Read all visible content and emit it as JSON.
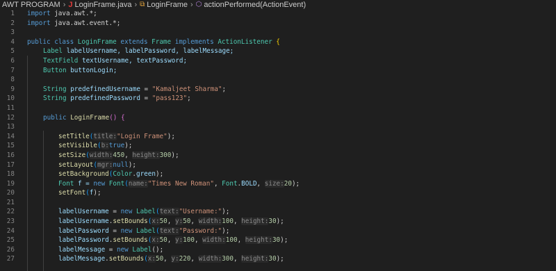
{
  "breadcrumb": {
    "project": "AWT PROGRAM",
    "file": "LoginFrame.java",
    "class": "LoginFrame",
    "method": "actionPerformed(ActionEvent)"
  },
  "line_numbers": [
    "1",
    "2",
    "3",
    "4",
    "5",
    "6",
    "7",
    "8",
    "9",
    "10",
    "11",
    "12",
    "13",
    "14",
    "15",
    "16",
    "17",
    "18",
    "19",
    "20",
    "21",
    "22",
    "23",
    "24",
    "25",
    "26",
    "27"
  ],
  "code": {
    "l1": [
      "import",
      " java.awt.*;"
    ],
    "l2": [
      "import",
      " java.awt.event.*;"
    ],
    "l4": [
      "public",
      " class ",
      "LoginFrame",
      " extends ",
      "Frame",
      " implements ",
      "ActionListener",
      " ",
      "{"
    ],
    "l5": [
      "Label",
      " labelUsername, labelPassword, labelMessage;"
    ],
    "l6": [
      "TextField",
      " textUsername, textPassword;"
    ],
    "l7": [
      "Button",
      " buttonLogin;"
    ],
    "l9": [
      "String",
      " predefinedUsername",
      " = ",
      "\"Kamaljeet Sharma\"",
      ";"
    ],
    "l10": [
      "String",
      " predefinedPassword",
      " = ",
      "\"pass123\"",
      ";"
    ],
    "l12": [
      "public",
      " ",
      "LoginFrame",
      "()",
      " ",
      "{"
    ],
    "l14": [
      "setTitle",
      "(",
      "title:",
      "\"Login Frame\"",
      ");"
    ],
    "l15": [
      "setVisible",
      "(",
      "b:",
      "true",
      ");"
    ],
    "l16": [
      "setSize",
      "(",
      "width:",
      "450",
      ", ",
      "height:",
      "300",
      ");"
    ],
    "l17": [
      "setLayout",
      "(",
      "mgr:",
      "null",
      ");"
    ],
    "l18": [
      "setBackground",
      "(",
      "Color",
      ".",
      "green",
      ");"
    ],
    "l19": [
      "Font",
      " f = ",
      "new",
      " ",
      "Font",
      "(",
      "name:",
      "\"Times New Roman\"",
      ", ",
      "Font",
      ".",
      "BOLD",
      ", ",
      "size:",
      "20",
      ");"
    ],
    "l20": [
      "setFont",
      "(",
      "f",
      ");"
    ],
    "l22": [
      "labelUsername",
      " = ",
      "new",
      " ",
      "Label",
      "(",
      "text:",
      "\"Username:\"",
      ");"
    ],
    "l23": [
      "labelUsername",
      ".",
      "setBounds",
      "(",
      "x:",
      "50",
      ", ",
      "y:",
      "50",
      ", ",
      "width:",
      "100",
      ", ",
      "height:",
      "30",
      ");"
    ],
    "l24": [
      "labelPassword",
      " = ",
      "new",
      " ",
      "Label",
      "(",
      "text:",
      "\"Password:\"",
      ");"
    ],
    "l25": [
      "labelPassword",
      ".",
      "setBounds",
      "(",
      "x:",
      "50",
      ", ",
      "y:",
      "100",
      ", ",
      "width:",
      "100",
      ", ",
      "height:",
      "30",
      ");"
    ],
    "l26": [
      "labelMessage",
      " = ",
      "new",
      " ",
      "Label",
      "();"
    ],
    "l27": [
      "labelMessage",
      ".",
      "setBounds",
      "(",
      "x:",
      "50",
      ", ",
      "y:",
      "220",
      ", ",
      "width:",
      "300",
      ", ",
      "height:",
      "30",
      ");"
    ]
  },
  "colors": {
    "background": "#1f1f1f",
    "keyword": "#569cd6",
    "type": "#4ec9b0",
    "string": "#ce9178",
    "function": "#dcdcaa",
    "variable": "#9cdcfe"
  }
}
